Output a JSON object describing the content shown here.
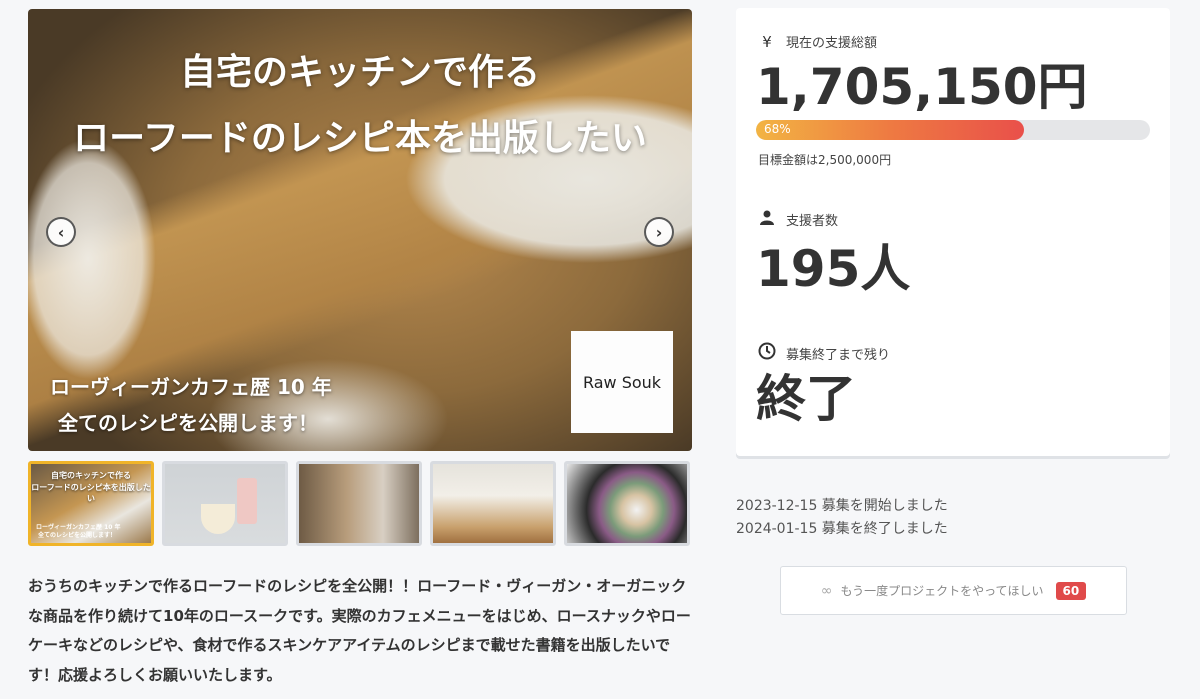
{
  "hero": {
    "title_line1": "自宅のキッチンで作る",
    "title_line2": "ローフードのレシピ本を出版したい",
    "sub_line1": "ローヴィーガンカフェ歴 10 年",
    "sub_line2": "全てのレシピを公開します！",
    "logo_text": "Raw Souk",
    "prev_symbol": "‹",
    "next_symbol": "›"
  },
  "thumbnails": [
    {
      "title_line1": "自宅のキッチンで作る",
      "title_line2": "ローフードのレシピ本を出版したい",
      "sub_line1": "ローヴィーガンカフェ歴 10 年",
      "sub_line2": "全てのレシピを公開します！",
      "active": true
    },
    {
      "active": false
    },
    {
      "active": false
    },
    {
      "active": false
    },
    {
      "active": false
    }
  ],
  "description": "おうちのキッチンで作るローフードのレシピを全公開！！ローフード・ヴィーガン・オーガニックな商品を作り続けて10年のロースークです。実際のカフェメニューをはじめ、ロースナックやローケーキなどのレシピや、食材で作るスキンケアアイテムのレシピまで載せた書籍を出版したいです！応援よろしくお願いいたします。",
  "stats": {
    "amount_icon": "yen-icon",
    "amount_label": "現在の支援総額",
    "amount_value": "1,705,150円",
    "progress_percent": 68,
    "progress_label": "68%",
    "goal_text": "目標金額は2,500,000円",
    "supporters_icon": "person-icon",
    "supporters_label": "支援者数",
    "supporters_value": "195人",
    "remaining_icon": "clock-icon",
    "remaining_label": "募集終了まで残り",
    "remaining_value": "終了"
  },
  "dates": {
    "start": "2023-12-15 募集を開始しました",
    "end": "2024-01-15 募集を終了しました"
  },
  "again_button": {
    "icon": "infinity-icon",
    "label": "もう一度プロジェクトをやってほしい",
    "count": "60"
  },
  "colors": {
    "progress_start": "#f2b443",
    "progress_end": "#e9504a",
    "badge": "#e04a4a",
    "active_thumb_border": "#f0b429"
  }
}
